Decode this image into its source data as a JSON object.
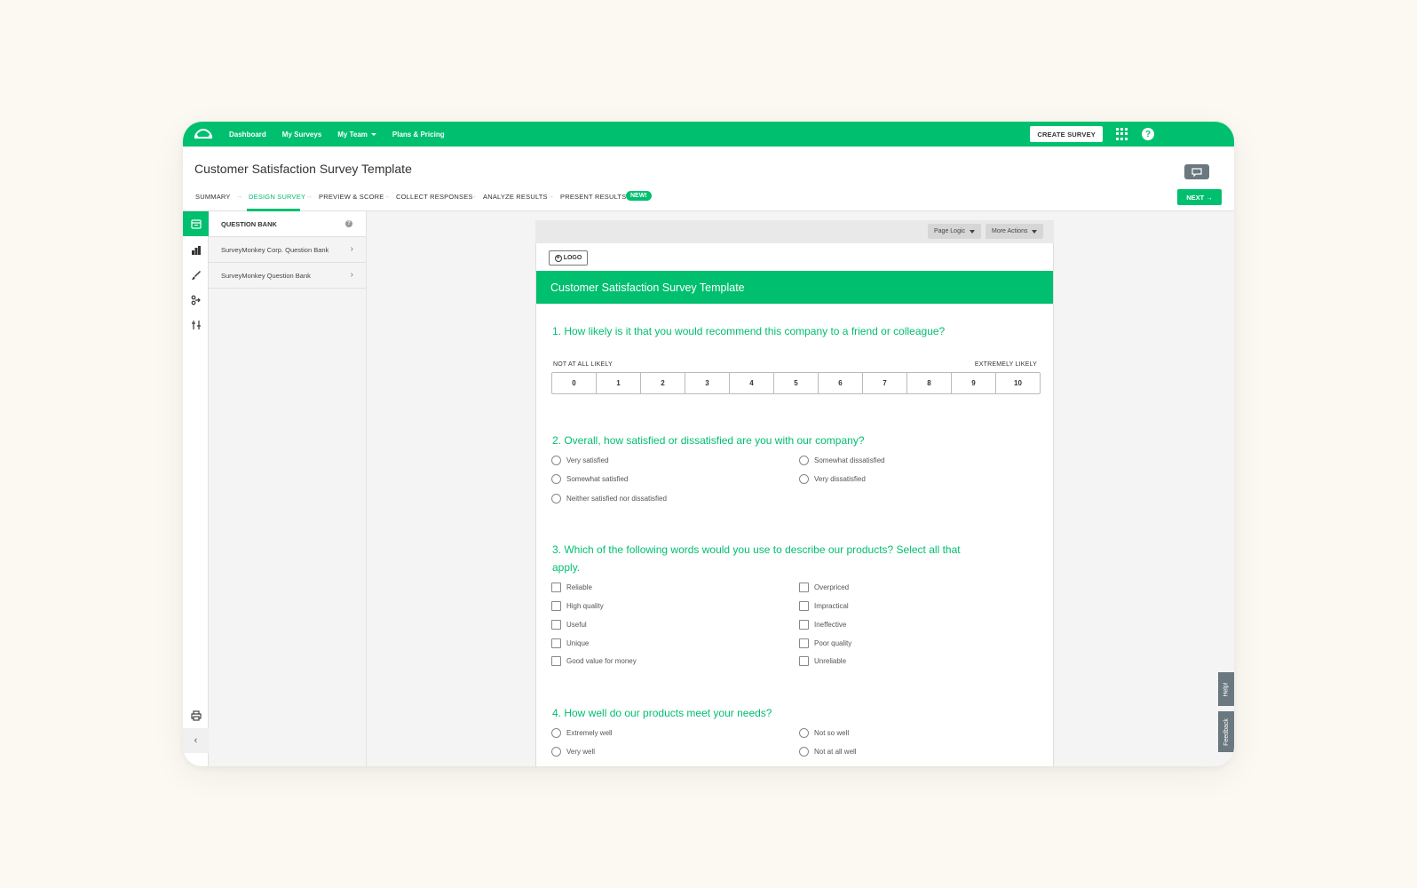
{
  "nav": {
    "links": [
      "Dashboard",
      "My Surveys",
      "My Team",
      "Plans & Pricing"
    ],
    "create_label": "CREATE SURVEY"
  },
  "title": "Customer Satisfaction Survey Template",
  "steps": [
    "SUMMARY",
    "DESIGN SURVEY",
    "PREVIEW & SCORE",
    "COLLECT RESPONSES",
    "ANALYZE RESULTS",
    "PRESENT RESULTS"
  ],
  "new_badge": "NEW!",
  "next_label": "NEXT",
  "bank": {
    "header": "QUESTION BANK",
    "items": [
      "SurveyMonkey Corp. Question Bank",
      "SurveyMonkey Question Bank"
    ]
  },
  "toolbar": {
    "page_logic": "Page Logic",
    "more_actions": "More Actions"
  },
  "survey": {
    "logo_label": "LOGO",
    "banner": "Customer Satisfaction Survey Template",
    "q1": {
      "title": "1. How likely is it that you would recommend this company to a friend or colleague?",
      "low_label": "NOT AT ALL LIKELY",
      "high_label": "EXTREMELY LIKELY",
      "scale": [
        "0",
        "1",
        "2",
        "3",
        "4",
        "5",
        "6",
        "7",
        "8",
        "9",
        "10"
      ]
    },
    "q2": {
      "title": "2. Overall, how satisfied or dissatisfied are you with our company?",
      "options": [
        "Very satisfied",
        "Somewhat satisfied",
        "Neither satisfied nor dissatisfied",
        "Somewhat dissatisfied",
        "Very dissatisfied"
      ]
    },
    "q3": {
      "title_line1": "3. Which of the following words would you use to describe our products? Select all that",
      "title_line2": "apply.",
      "options": [
        "Reliable",
        "High quality",
        "Useful",
        "Unique",
        "Good value for money",
        "Overpriced",
        "Impractical",
        "Ineffective",
        "Poor quality",
        "Unreliable"
      ]
    },
    "q4": {
      "title": "4. How well do our products meet your needs?",
      "options": [
        "Extremely well",
        "Very well",
        "Not so well",
        "Not at all well"
      ]
    }
  },
  "side_tabs": {
    "help": "Help!",
    "feedback": "Feedback"
  },
  "colors": {
    "brand": "#00bf6f",
    "slate": "#6b787f"
  }
}
